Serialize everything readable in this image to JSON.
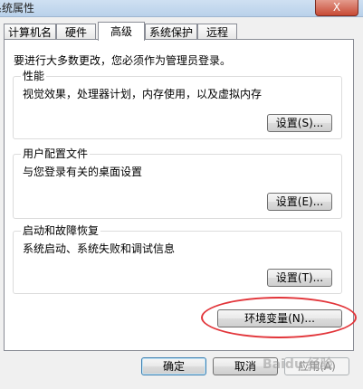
{
  "window": {
    "title": "系统属性",
    "close_label": "X"
  },
  "tabs": [
    {
      "label": "计算机名"
    },
    {
      "label": "硬件"
    },
    {
      "label": "高级"
    },
    {
      "label": "系统保护"
    },
    {
      "label": "远程"
    }
  ],
  "active_tab": "高级",
  "note": "要进行大多数更改，您必须作为管理员登录。",
  "groups": {
    "performance": {
      "title": "性能",
      "desc": "视觉效果，处理器计划，内存使用，以及虚拟内存",
      "button": "设置(S)..."
    },
    "profiles": {
      "title": "用户配置文件",
      "desc": "与您登录有关的桌面设置",
      "button": "设置(E)..."
    },
    "startup": {
      "title": "启动和故障恢复",
      "desc": "系统启动、系统失败和调试信息",
      "button": "设置(T)..."
    }
  },
  "env_button": "环境变量(N)...",
  "footer": {
    "ok": "确定",
    "cancel": "取消",
    "apply": "应用(A)"
  },
  "watermark": "Baidu 经验",
  "colors": {
    "highlight_ellipse": "#e2353a",
    "focus_border": "#3c7fb1"
  }
}
